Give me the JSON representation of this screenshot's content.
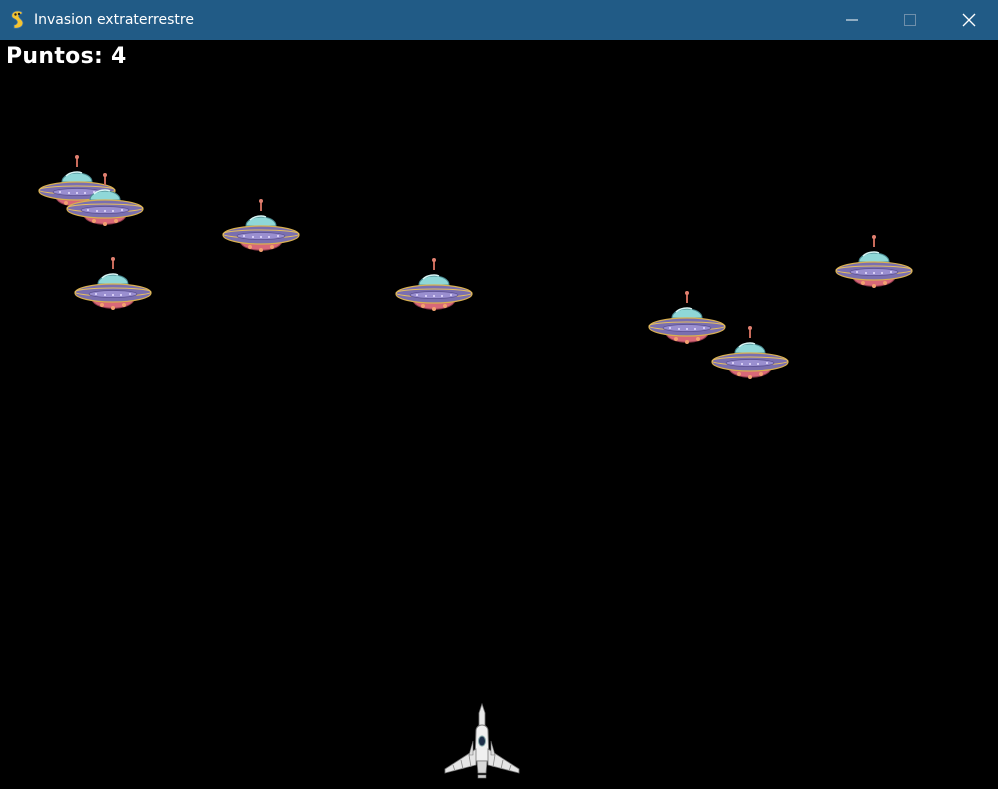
{
  "window": {
    "title": "Invasion extraterrestre",
    "app_icon": "pygame-snake-icon",
    "controls": [
      "minimize-icon",
      "maximize-icon",
      "close-icon"
    ],
    "titlebar_color": "#215b86"
  },
  "game": {
    "background": "#000000",
    "score_text": "Puntos: 4",
    "aliens_remaining": 8,
    "player_ship": "white-fighter-jet"
  }
}
